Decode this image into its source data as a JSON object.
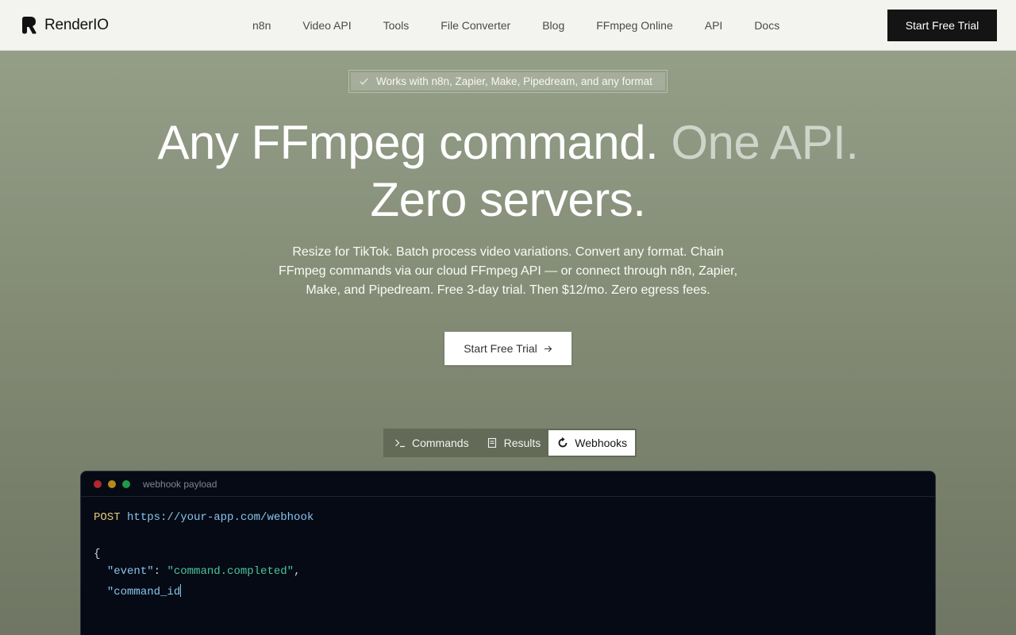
{
  "nav": {
    "brand": "RenderIO",
    "links": [
      "n8n",
      "Video API",
      "Tools",
      "File Converter",
      "Blog",
      "FFmpeg Online",
      "API",
      "Docs"
    ],
    "cta": "Start Free Trial"
  },
  "hero": {
    "badge": "Works with n8n, Zapier, Make, Pipedream, and any format",
    "title_main": "Any FFmpeg command.",
    "title_dim": "One API.",
    "title_line2": "Zero servers.",
    "subtitle": "Resize for TikTok. Batch process video variations. Convert any format. Chain FFmpeg commands via our cloud FFmpeg API — or connect through n8n, Zapier, Make, and Pipedream. Free 3-day trial. Then $12/mo. Zero egress fees.",
    "cta": "Start Free Trial"
  },
  "tabs": {
    "items": [
      "Commands",
      "Results",
      "Webhooks"
    ],
    "active": "Webhooks"
  },
  "terminal": {
    "title": "webhook payload",
    "method": "POST",
    "url": "https://your-app.com/webhook",
    "open_brace": "{",
    "event_key": "\"event\"",
    "event_value": "\"command.completed\"",
    "command_key": "\"command_id"
  },
  "colors": {
    "nav_bg": "#f3f3ef",
    "cta_bg": "#141414",
    "terminal_bg": "#050a14",
    "string": "#4cc49b",
    "key": "#8ac4ee",
    "method": "#e8c97a"
  }
}
